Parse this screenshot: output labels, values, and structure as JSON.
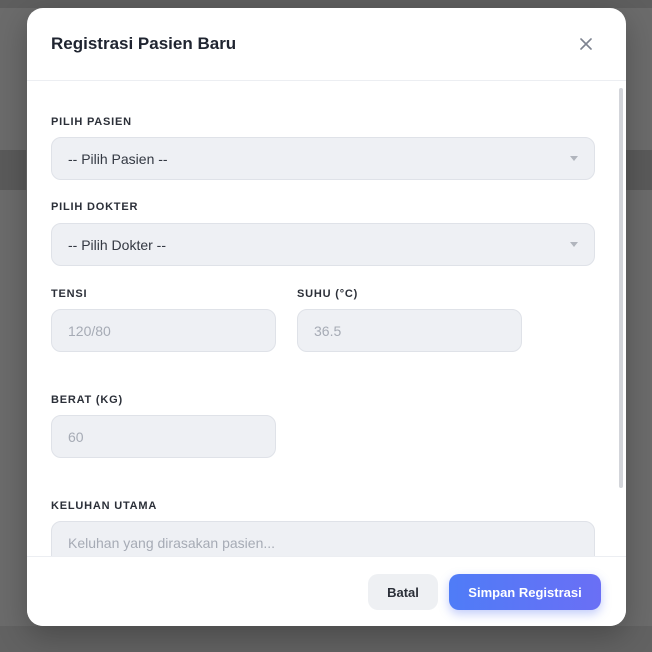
{
  "modal": {
    "title": "Registrasi Pasien Baru"
  },
  "form": {
    "patient": {
      "label": "PILIH PASIEN",
      "selected": "-- Pilih Pasien --"
    },
    "doctor": {
      "label": "PILIH DOKTER",
      "selected": "-- Pilih Dokter --"
    },
    "blood_pressure": {
      "label": "TENSI",
      "placeholder": "120/80"
    },
    "temperature": {
      "label": "SUHU (°C)",
      "placeholder": "36.5"
    },
    "weight": {
      "label": "BERAT (KG)",
      "placeholder": "60"
    },
    "complaint": {
      "label": "KELUHAN UTAMA",
      "placeholder": "Keluhan yang dirasakan pasien..."
    }
  },
  "footer": {
    "cancel_label": "Batal",
    "save_label": "Simpan Registrasi"
  },
  "icons": {
    "close": "close-icon",
    "dropdown": "chevron-down-icon"
  },
  "colors": {
    "primary": "#4f7cf7",
    "overlay": "#6b6b6b"
  }
}
